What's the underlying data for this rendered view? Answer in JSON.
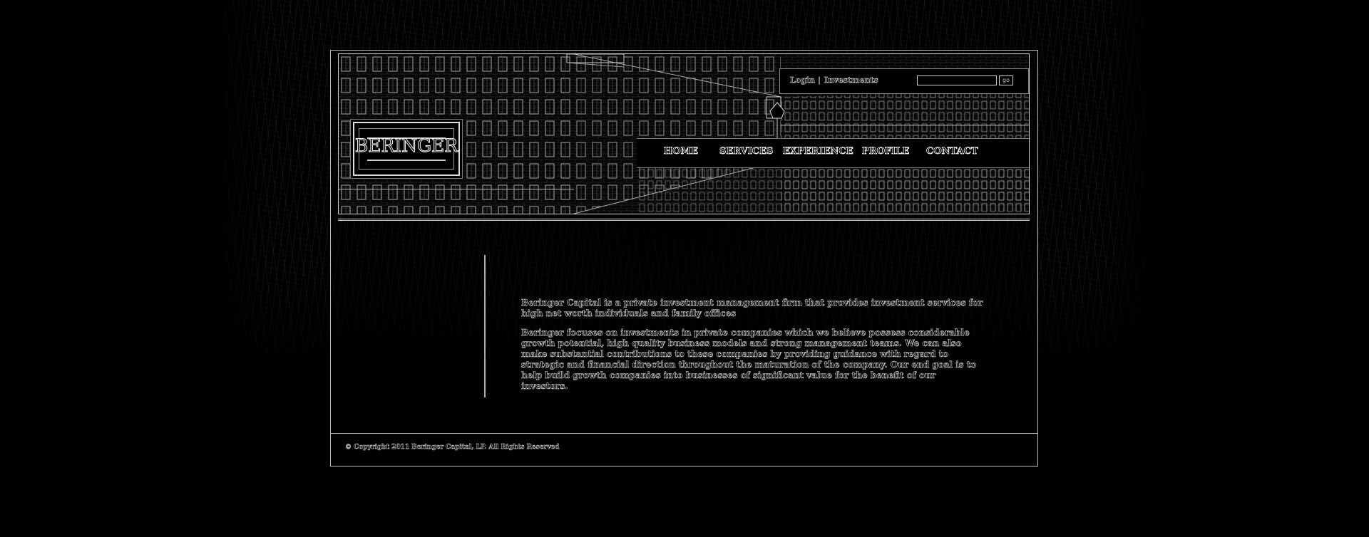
{
  "brand": {
    "logo_text": "BERINGER"
  },
  "login_bar": {
    "login_label": "Login",
    "separator": "|",
    "investments_label": "Investments",
    "search_value": "",
    "go_label": "go"
  },
  "nav": {
    "items": [
      {
        "label": "HOME"
      },
      {
        "label": "SERVICES"
      },
      {
        "label": "EXPERIENCE"
      },
      {
        "label": "PROFILE"
      },
      {
        "label": "CONTACT"
      }
    ]
  },
  "content": {
    "paragraph_1": "Beringer Capital is a private investment management firm that provides investment services for high net worth individuals and family offices",
    "paragraph_2": "Beringer focuses on investments in private companies which we believe possess considerable growth potential, high quality business models and strong management teams. We can also make substantial contributions to these companies by providing guidance with regard to strategic and financial direction throughout the maturation of the company. Our end goal is to help build growth companies into businesses of significant value for the benefit of our investors."
  },
  "footer": {
    "copyright": "© Copyright 2011 Beringer Capital, LP. All Rights Reserved"
  },
  "colors": {
    "background": "#000000",
    "line": "#cfcfcf",
    "text_outline": "#e6e6e6"
  }
}
